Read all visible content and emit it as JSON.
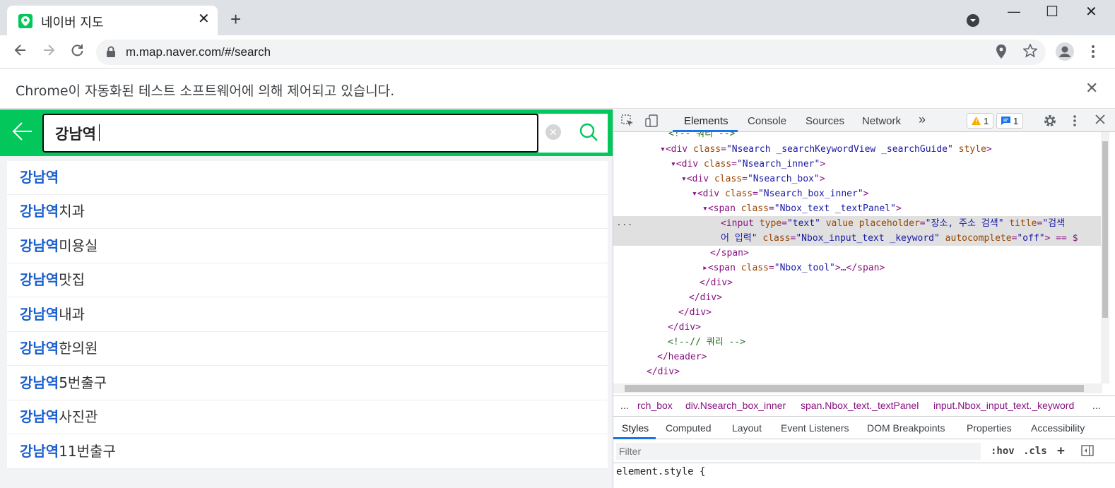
{
  "browser": {
    "tab_title": "네이버 지도",
    "tab_close": "✕",
    "new_tab": "+",
    "url": "m.map.naver.com/#/search",
    "window_controls": {
      "minimize": "—",
      "maximize": "☐",
      "close": "✕"
    },
    "infobar_text": "Chrome이 자동화된 테스트 소프트웨어에 의해 제어되고 있습니다.",
    "infobar_close": "✕",
    "icons": [
      "back-icon",
      "forward-icon",
      "reload-icon",
      "lock-icon",
      "location-icon",
      "star-icon",
      "profile-icon",
      "menu-icon"
    ]
  },
  "page": {
    "search_value": "강남역",
    "clear_label": "✕",
    "suggestions": [
      {
        "highlight": "강남역",
        "rest": ""
      },
      {
        "highlight": "강남역",
        "rest": "치과"
      },
      {
        "highlight": "강남역",
        "rest": "미용실"
      },
      {
        "highlight": "강남역",
        "rest": "맛집"
      },
      {
        "highlight": "강남역",
        "rest": "내과"
      },
      {
        "highlight": "강남역",
        "rest": "한의원"
      },
      {
        "highlight": "강남역",
        "rest": "5번출구"
      },
      {
        "highlight": "강남역",
        "rest": "사진관"
      },
      {
        "highlight": "강남역",
        "rest": "11번출구"
      }
    ],
    "colors": {
      "brand_green": "#03c75a",
      "highlight_blue": "#1a5fcf"
    }
  },
  "devtools": {
    "tabs": [
      "Elements",
      "Console",
      "Sources",
      "Network"
    ],
    "more_tabs": "»",
    "warning_count": "1",
    "message_count": "1",
    "code_lines": {
      "l0": "<!-- 쿼리 -->",
      "l1_tag": "<div ",
      "l1_attr": "class",
      "l1_val": "\"Nsearch _searchKeywordView _searchGuide\"",
      "l1_attr2": " style",
      "l1_end": ">",
      "l2_tag": "<div ",
      "l2_attr": "class",
      "l2_val": "\"Nsearch_inner\"",
      "l2_end": ">",
      "l3_tag": "<div ",
      "l3_attr": "class",
      "l3_val": "\"Nsearch_box\"",
      "l3_end": ">",
      "l4_tag": "<div ",
      "l4_attr": "class",
      "l4_val": "\"Nsearch_box_inner\"",
      "l4_end": ">",
      "l5_tag": "<span ",
      "l5_attr": "class",
      "l5_val": "\"Nbox_text _textPanel\"",
      "l5_end": ">",
      "l6a": "<input ",
      "l6b": "type",
      "l6c": "\"text\"",
      "l6d": " value placeholder",
      "l6e": "\"장소, 주소 검색\"",
      "l6f": " title",
      "l6g": "\"검색",
      "l7a": "어 입력\"",
      "l7b": " class",
      "l7c": "\"Nbox_input_text _keyword\"",
      "l7d": " autocomplete",
      "l7e": "\"off\"",
      "l7f": "> == $",
      "l8": "</span>",
      "l9_tag": "<span ",
      "l9_attr": "class",
      "l9_val": "\"Nbox_tool\"",
      "l9_end": ">…</span>",
      "l10": "</div>",
      "l11": "</div>",
      "l12": "</div>",
      "l13": "</div>",
      "l14": "<!--// 쿼리 -->",
      "l15": "</header>",
      "l16": "</div>"
    },
    "ellipsis": "...",
    "breadcrumbs": [
      "...",
      "rch_box",
      "div.Nsearch_box_inner",
      "span.Nbox_text._textPanel",
      "input.Nbox_input_text._keyword",
      "..."
    ],
    "style_tabs": [
      "Styles",
      "Computed",
      "Layout",
      "Event Listeners",
      "DOM Breakpoints",
      "Properties",
      "Accessibility"
    ],
    "filter_placeholder": "Filter",
    "hov": ":hov",
    "cls": ".cls",
    "plus": "+",
    "element_style": "element.style {"
  }
}
